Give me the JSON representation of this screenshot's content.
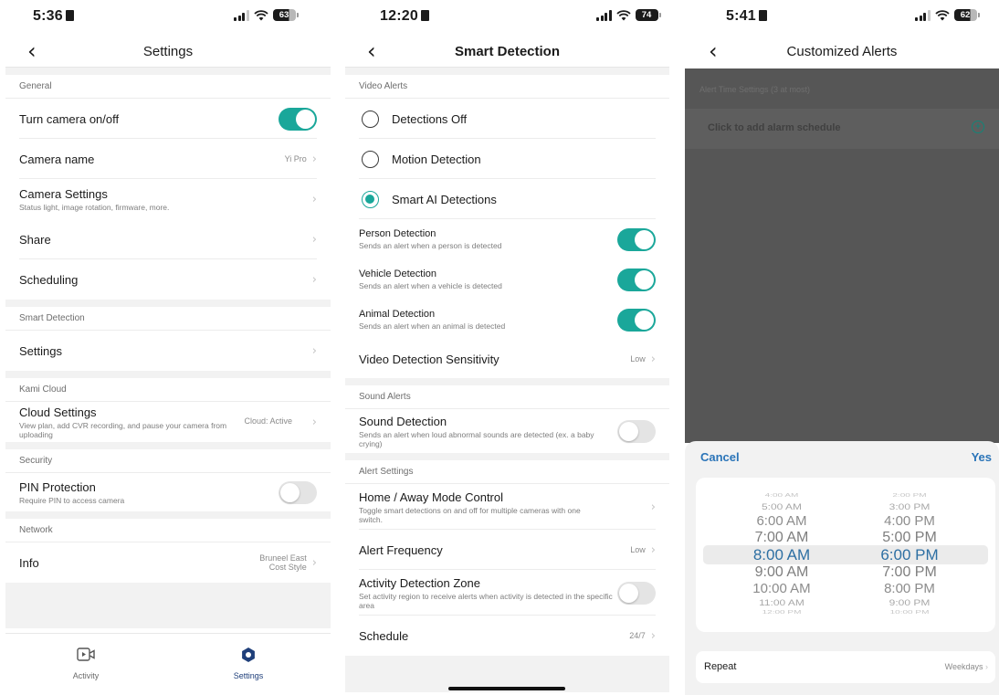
{
  "screens": {
    "settings": {
      "time": "5:36",
      "battery": "63",
      "title": "Settings",
      "sections": [
        {
          "header": "General"
        },
        {
          "header": "Smart Detection"
        },
        {
          "header": "Kami Cloud"
        },
        {
          "header": "Security"
        },
        {
          "header": "Network"
        }
      ],
      "rows": {
        "camera_toggle": {
          "label": "Turn camera on/off",
          "state": "on"
        },
        "camera_name": {
          "label": "Camera name",
          "value": "Yi Pro"
        },
        "camera_settings": {
          "label": "Camera Settings",
          "sub": "Status light, image rotation, firmware, more."
        },
        "share": {
          "label": "Share"
        },
        "scheduling": {
          "label": "Scheduling"
        },
        "smart_settings": {
          "label": "Settings"
        },
        "cloud_settings": {
          "label": "Cloud Settings",
          "sub": "View plan, add CVR recording, and pause your camera from uploading",
          "value": "Cloud: Active"
        },
        "pin": {
          "label": "PIN Protection",
          "sub": "Require PIN to access camera",
          "state": "off"
        },
        "info": {
          "label": "Info",
          "value_line1": "Bruneel East",
          "value_line2": "Cost Style"
        }
      },
      "tabs": [
        {
          "label": "Activity",
          "icon": "video-camera-icon"
        },
        {
          "label": "Settings",
          "icon": "gear-icon",
          "active": true
        }
      ]
    },
    "smart_detection": {
      "time": "12:20",
      "battery": "74",
      "title": "Smart Detection",
      "video_alerts_header": "Video Alerts",
      "options": [
        "Detections Off",
        "Motion Detection",
        "Smart AI Detections"
      ],
      "selected_option": "Smart AI Detections",
      "person": {
        "label": "Person Detection",
        "sub": "Sends an alert when a person is detected",
        "state": "on"
      },
      "vehicle": {
        "label": "Vehicle Detection",
        "sub": "Sends an alert when a vehicle is detected",
        "state": "on"
      },
      "animal": {
        "label": "Animal Detection",
        "sub": "Sends an alert when an animal is detected",
        "state": "on"
      },
      "sensitivity": {
        "label": "Video Detection Sensitivity",
        "value": "Low"
      },
      "sound_alerts_header": "Sound Alerts",
      "sound": {
        "label": "Sound Detection",
        "sub": "Sends an alert when loud abnormal sounds are detected (ex. a baby crying)",
        "state": "off"
      },
      "alert_settings_header": "Alert Settings",
      "home_away": {
        "label": "Home / Away Mode Control",
        "sub": "Toggle smart detections on and off for multiple cameras with one switch."
      },
      "frequency": {
        "label": "Alert Frequency",
        "value": "Low"
      },
      "zone": {
        "label": "Activity Detection Zone",
        "sub": "Set activity region to receive alerts when activity is detected in the specific area",
        "state": "off"
      },
      "schedule": {
        "label": "Schedule",
        "value": "24/7"
      }
    },
    "custom_alerts": {
      "time": "5:41",
      "battery": "62",
      "title": "Customized Alerts",
      "time_settings_header": "Alert Time Settings (3 at most)",
      "add_schedule": "Click to add alarm schedule",
      "cancel": "Cancel",
      "confirm": "Yes",
      "start_times": [
        "4:00 AM",
        "5:00 AM",
        "6:00 AM",
        "7:00 AM",
        "8:00 AM",
        "9:00 AM",
        "10:00 AM",
        "11:00 AM",
        "12:00 PM"
      ],
      "end_times": [
        "2:00 PM",
        "3:00 PM",
        "4:00 PM",
        "5:00 PM",
        "6:00 PM",
        "7:00 PM",
        "8:00 PM",
        "9:00 PM",
        "10:00 PM"
      ],
      "selected_start": "8:00 AM",
      "selected_end": "6:00 PM",
      "repeat": {
        "label": "Repeat",
        "value": "Weekdays"
      }
    }
  },
  "colors": {
    "accent": "#1aa79a",
    "link": "#2a74b8",
    "picker_selected": "#2d6fa3"
  }
}
